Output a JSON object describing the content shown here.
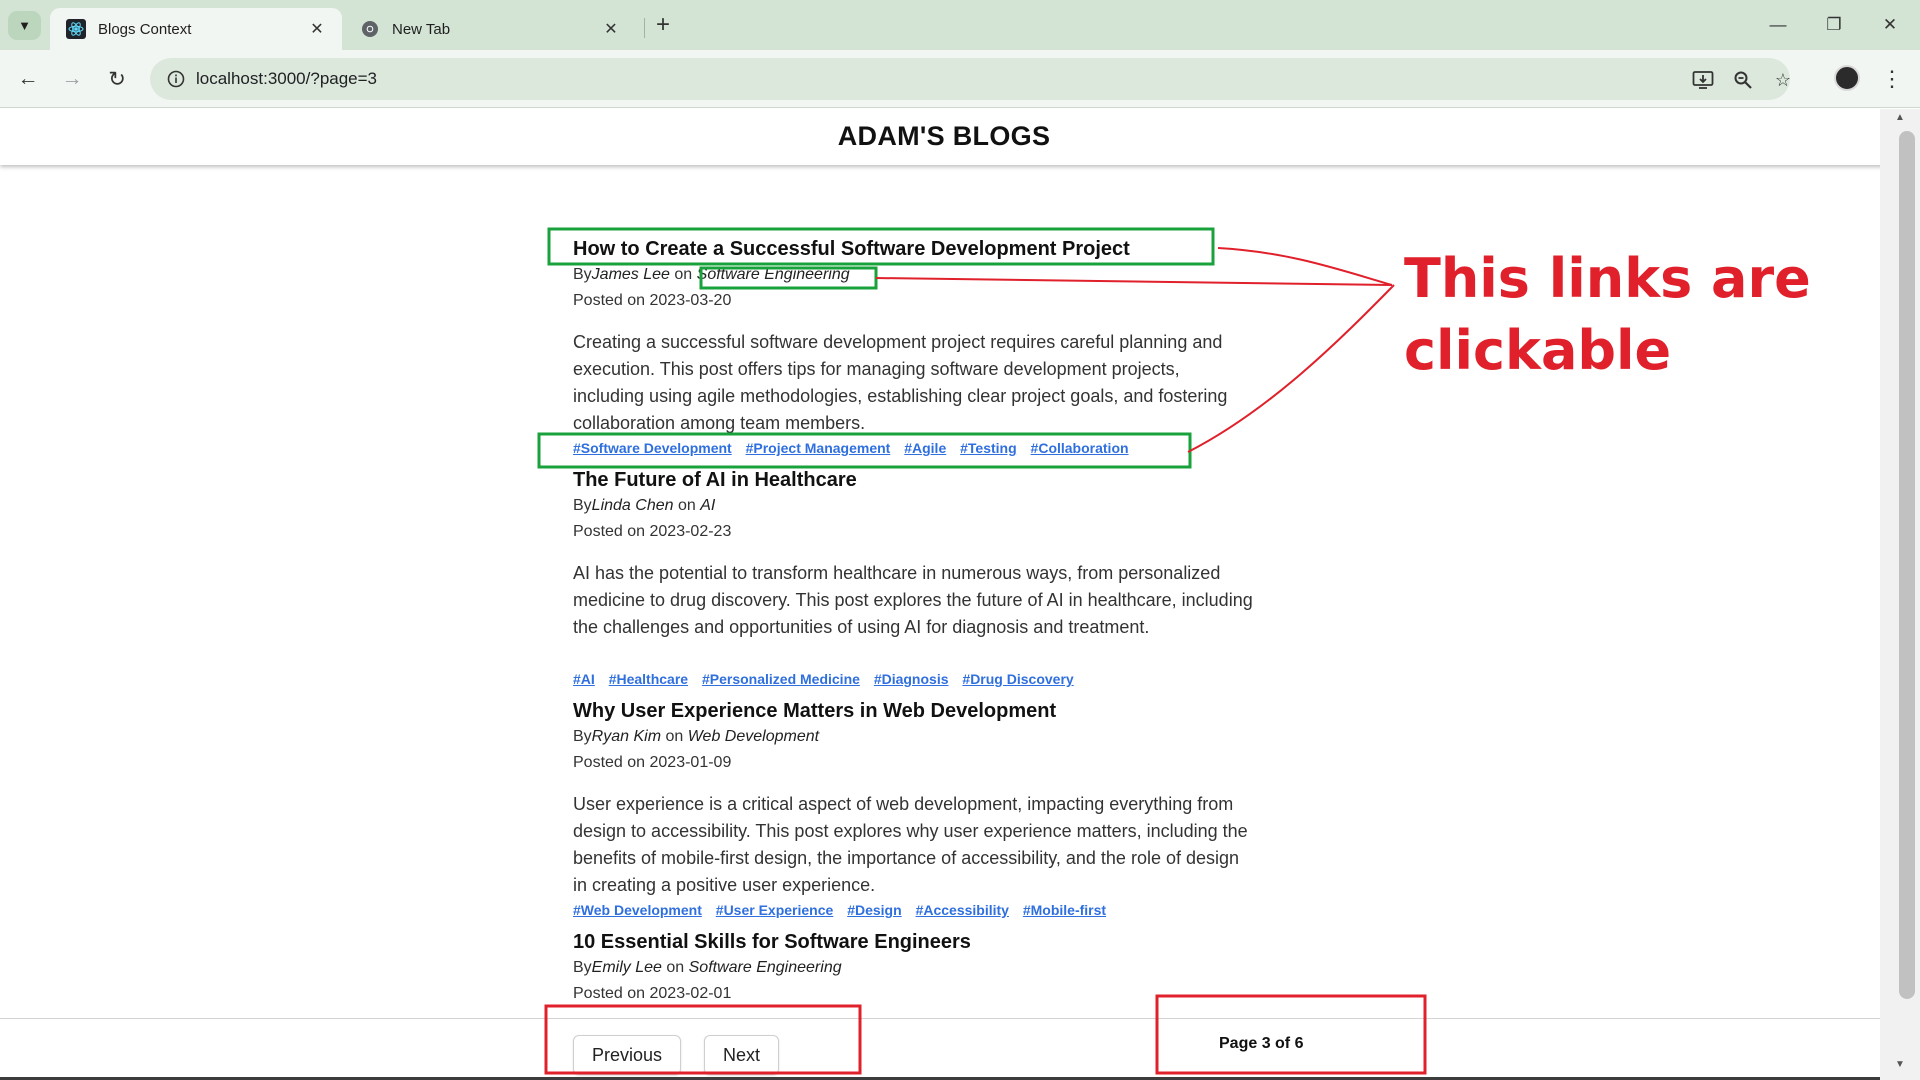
{
  "browser": {
    "tabs": [
      {
        "title": "Blogs Context",
        "active": true
      },
      {
        "title": "New Tab",
        "active": false
      }
    ],
    "url": "localhost:3000/?page=3"
  },
  "site": {
    "title": "ADAM'S BLOGS"
  },
  "posts": [
    {
      "title": "How to Create a Successful Software Development Project",
      "by": "By",
      "author": "James Lee",
      "on": "on",
      "category": "Software Engineering",
      "date": "Posted on 2023-03-20",
      "body": "Creating a successful software development project requires careful planning and execution. This post offers tips for managing software development projects, including using agile methodologies, establishing clear project goals, and fostering collaboration among team members.",
      "tags": [
        "#Software Development",
        "#Project Management",
        "#Agile",
        "#Testing",
        "#Collaboration"
      ]
    },
    {
      "title": "The Future of AI in Healthcare",
      "by": "By",
      "author": "Linda Chen",
      "on": "on",
      "category": "AI",
      "date": "Posted on 2023-02-23",
      "body": "AI has the potential to transform healthcare in numerous ways, from personalized medicine to drug discovery. This post explores the future of AI in healthcare, including the challenges and opportunities of using AI for diagnosis and treatment.",
      "tags": [
        "#AI",
        "#Healthcare",
        "#Personalized Medicine",
        "#Diagnosis",
        "#Drug Discovery"
      ]
    },
    {
      "title": "Why User Experience Matters in Web Development",
      "by": "By",
      "author": "Ryan Kim",
      "on": "on",
      "category": "Web Development",
      "date": "Posted on 2023-01-09",
      "body": "User experience is a critical aspect of web development, impacting everything from design to accessibility. This post explores why user experience matters, including the benefits of mobile-first design, the importance of accessibility, and the role of design in creating a positive user experience.",
      "tags": [
        "#Web Development",
        "#User Experience",
        "#Design",
        "#Accessibility",
        "#Mobile-first"
      ]
    },
    {
      "title": "10 Essential Skills for Software Engineers",
      "by": "By",
      "author": "Emily Lee",
      "on": "on",
      "category": "Software Engineering",
      "date": "Posted on 2023-02-01",
      "body": "",
      "tags": []
    }
  ],
  "pagination": {
    "previous_label": "Previous",
    "next_label": "Next",
    "page_info": "Page 3 of 6"
  },
  "annotation": {
    "line1": "This links are",
    "line2": "clickable",
    "color": "#e0202a",
    "highlight_color": "#19a23b"
  }
}
